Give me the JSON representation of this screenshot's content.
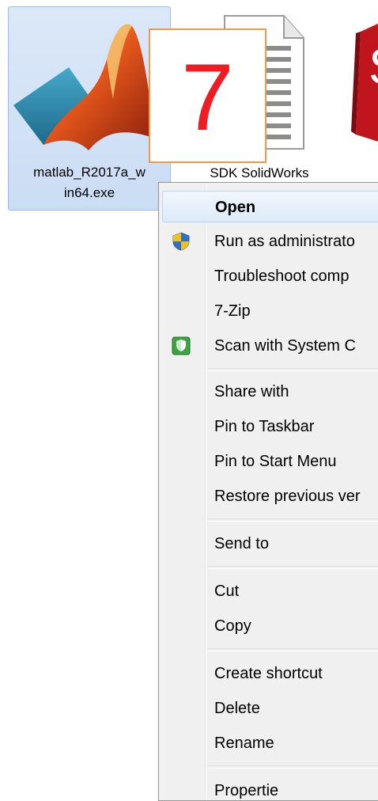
{
  "desktop": {
    "icons": [
      {
        "label_line1": "matlab_R2017a_w",
        "label_line2": "in64.exe",
        "icon": "matlab-logo-icon"
      },
      {
        "label": "SDK SolidWorks",
        "icon": "text-document-icon"
      },
      {
        "icon": "solidworks-logo-icon"
      }
    ],
    "badge_number": "7",
    "badge_color": "#ee1c23"
  },
  "context_menu": {
    "items": [
      {
        "label": "Open",
        "bold": true,
        "highlighted": true
      },
      {
        "label": "Run as administrato",
        "icon": "uac-shield-icon"
      },
      {
        "label": "Troubleshoot comp"
      },
      {
        "label": "7-Zip"
      },
      {
        "label": "Scan with System C",
        "icon": "security-shield-icon"
      },
      {
        "label": "Share with"
      },
      {
        "label": "Pin to Taskbar"
      },
      {
        "label": "Pin to Start Menu"
      },
      {
        "label": "Restore previous ver"
      },
      {
        "label": "Send to"
      },
      {
        "label": "Cut"
      },
      {
        "label": "Copy"
      },
      {
        "label": "Create shortcut"
      },
      {
        "label": "Delete"
      },
      {
        "label": "Rename"
      },
      {
        "label": "Propertie"
      }
    ]
  }
}
